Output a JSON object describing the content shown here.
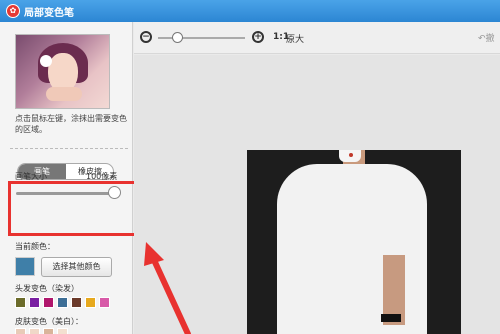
{
  "window": {
    "title": "局部变色笔",
    "logo_glyph": "✿"
  },
  "left_panel": {
    "hint": "点击鼠标左键，涂抹出需要变色的区域。",
    "mode_toggle": {
      "brush_label": "画笔",
      "eraser_label": "橡皮擦",
      "selected": "画笔"
    },
    "brush_size": {
      "label": "画笔大小",
      "value_text": "100像素",
      "level_fraction": 1.0
    },
    "current_color": {
      "label": "当前颜色：",
      "swatch": "#3f7fa8",
      "choose_button": "选择其他颜色"
    },
    "hair_color": {
      "label": "头发变色（染发）",
      "swatches": [
        "#6b6b2a",
        "#7a1fa2",
        "#b0166c",
        "#3d6e96",
        "#6b3a2a",
        "#e7a91e",
        "#d85aa8"
      ]
    },
    "skin_color": {
      "label": "皮肤变色（美白）：",
      "swatches": [
        "#e8cbb8",
        "#f0d8c8",
        "#d9b49a",
        "#f3e0d0"
      ]
    }
  },
  "toolbar": {
    "zoom_ratio": "1:1",
    "zoom_original_label": "原大",
    "undo_label": "撤",
    "zoom_level_fraction": 0.2
  },
  "annotation_colors": {
    "highlight": "#e8322f"
  }
}
